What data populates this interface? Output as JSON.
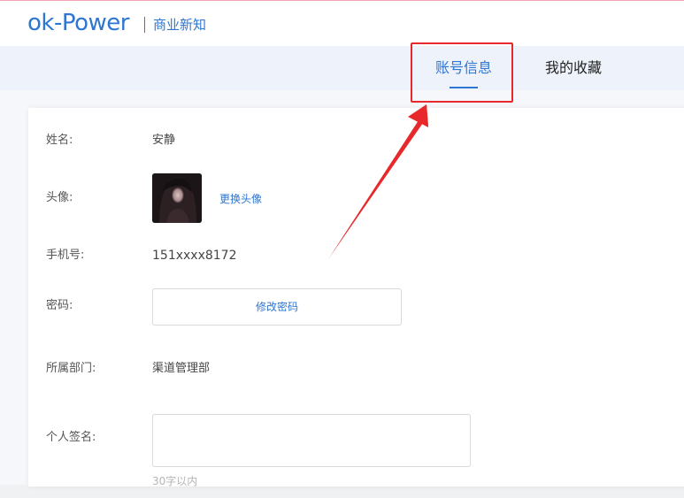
{
  "header": {
    "logo_text": "ok-Power",
    "subtitle": "商业新知"
  },
  "tabs": [
    {
      "label": "账号信息",
      "active": true
    },
    {
      "label": "我的收藏",
      "active": false
    }
  ],
  "profile": {
    "name_label": "姓名:",
    "name_value": "安静",
    "avatar_label": "头像:",
    "change_avatar_link": "更换头像",
    "phone_label": "手机号:",
    "phone_value": "151xxxx8172",
    "password_label": "密码:",
    "change_password_button": "修改密码",
    "department_label": "所属部门:",
    "department_value": "渠道管理部",
    "signature_label": "个人签名:",
    "signature_value": "",
    "signature_hint": "30字以内"
  },
  "colors": {
    "accent": "#2d76d2",
    "annotation_red": "#e8292c",
    "tabbar_bg": "#eef3fb"
  }
}
